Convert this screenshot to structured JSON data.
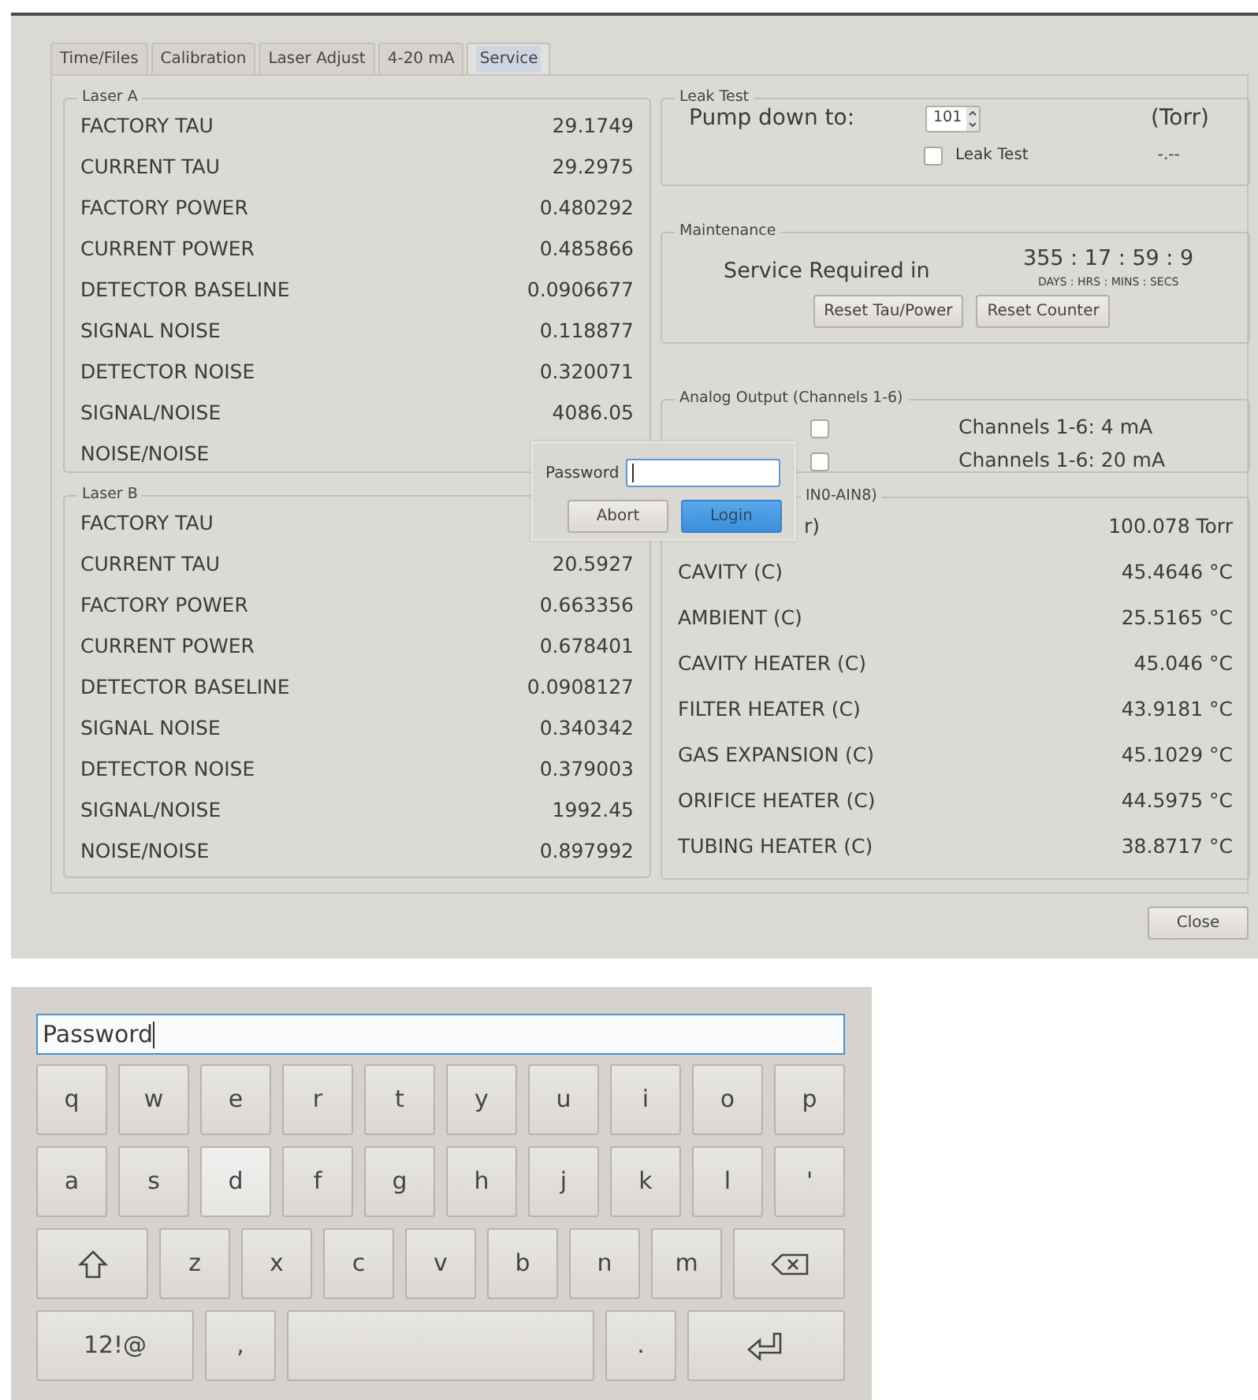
{
  "tabs": [
    {
      "label": "Time/Files",
      "selected": false
    },
    {
      "label": "Calibration",
      "selected": false
    },
    {
      "label": "Laser Adjust",
      "selected": false
    },
    {
      "label": "4-20 mA",
      "selected": false
    },
    {
      "label": "Service",
      "selected": true
    }
  ],
  "laser_a": {
    "title": "Laser A",
    "rows": [
      {
        "label": "FACTORY TAU",
        "value": "29.1749"
      },
      {
        "label": "CURRENT TAU",
        "value": "29.2975"
      },
      {
        "label": "FACTORY POWER",
        "value": "0.480292"
      },
      {
        "label": "CURRENT POWER",
        "value": "0.485866"
      },
      {
        "label": "DETECTOR BASELINE",
        "value": "0.0906677"
      },
      {
        "label": "SIGNAL NOISE",
        "value": "0.118877"
      },
      {
        "label": "DETECTOR NOISE",
        "value": "0.320071"
      },
      {
        "label": "SIGNAL/NOISE",
        "value": "4086.05"
      },
      {
        "label": "NOISE/NOISE"
      }
    ]
  },
  "laser_b": {
    "title": "Laser B",
    "rows": [
      {
        "label": "FACTORY TAU"
      },
      {
        "label": "CURRENT TAU",
        "value": "20.5927"
      },
      {
        "label": "FACTORY POWER",
        "value": "0.663356"
      },
      {
        "label": "CURRENT POWER",
        "value": "0.678401"
      },
      {
        "label": "DETECTOR BASELINE",
        "value": "0.0908127"
      },
      {
        "label": "SIGNAL NOISE",
        "value": "0.340342"
      },
      {
        "label": "DETECTOR NOISE",
        "value": "0.379003"
      },
      {
        "label": "SIGNAL/NOISE",
        "value": "1992.45"
      },
      {
        "label": "NOISE/NOISE",
        "value": "0.897992"
      }
    ]
  },
  "leak_test": {
    "title": "Leak Test",
    "pump_label": "Pump down to:",
    "pump_value": "101",
    "unit": "(Torr)",
    "checkbox": {
      "label": "Leak Test",
      "checked": false
    },
    "reading": "-.--"
  },
  "maintenance": {
    "title": "Maintenance",
    "label": "Service Required in",
    "countdown": "355 : 17 : 59 : 9",
    "units": "DAYS : HRS : MINS : SECS",
    "buttons": [
      "Reset Tau/Power",
      "Reset Counter"
    ]
  },
  "analog_output": {
    "title": "Analog Output (Channels 1-6)",
    "options": [
      {
        "label": "Channels 1-6: 4 mA",
        "checked": false
      },
      {
        "label": "Channels 1-6: 20 mA",
        "checked": false
      }
    ]
  },
  "analog_inputs": {
    "title": "IN0-AIN8)",
    "rows": [
      {
        "label": "r)",
        "value": "100.078 Torr"
      },
      {
        "label": "CAVITY (C)",
        "value": "45.4646 °C"
      },
      {
        "label": "AMBIENT (C)",
        "value": "25.5165 °C"
      },
      {
        "label": "CAVITY HEATER (C)",
        "value": "45.046 °C"
      },
      {
        "label": "FILTER HEATER (C)",
        "value": "43.9181 °C"
      },
      {
        "label": "GAS EXPANSION (C)",
        "value": "45.1029 °C"
      },
      {
        "label": "ORIFICE HEATER (C)",
        "value": "44.5975 °C"
      },
      {
        "label": "TUBING HEATER (C)",
        "value": "38.8717 °C"
      }
    ]
  },
  "password_dialog": {
    "label": "Password",
    "buttons": [
      {
        "label": "Abort",
        "default": false
      },
      {
        "label": "Login",
        "default": true
      }
    ]
  },
  "close_button": "Close",
  "keyboard": {
    "field_value": "Password",
    "top_row": [
      {
        "kind": "char",
        "label": "q",
        "pressed": false
      },
      {
        "kind": "char",
        "label": "w",
        "pressed": false
      },
      {
        "kind": "char",
        "label": "e",
        "pressed": false
      },
      {
        "kind": "char",
        "label": "r",
        "pressed": false
      },
      {
        "kind": "char",
        "label": "t",
        "pressed": false
      },
      {
        "kind": "char",
        "label": "y",
        "pressed": false
      },
      {
        "kind": "char",
        "label": "u",
        "pressed": false
      },
      {
        "kind": "char",
        "label": "i",
        "pressed": false
      },
      {
        "kind": "char",
        "label": "o",
        "pressed": false
      },
      {
        "kind": "char",
        "label": "p",
        "pressed": false
      }
    ],
    "home_row": [
      {
        "kind": "char",
        "label": "a",
        "pressed": false
      },
      {
        "kind": "char",
        "label": "s",
        "pressed": false
      },
      {
        "kind": "char",
        "label": "d",
        "pressed": true
      },
      {
        "kind": "char",
        "label": "f",
        "pressed": false
      },
      {
        "kind": "char",
        "label": "g",
        "pressed": false
      },
      {
        "kind": "char",
        "label": "h",
        "pressed": false
      },
      {
        "kind": "char",
        "label": "j",
        "pressed": false
      },
      {
        "kind": "char",
        "label": "k",
        "pressed": false
      },
      {
        "kind": "char",
        "label": "l",
        "pressed": false
      },
      {
        "kind": "char",
        "label": "'",
        "pressed": false
      }
    ],
    "bottom_row": [
      {
        "kind": "shift",
        "pressed": false
      },
      {
        "kind": "char",
        "label": "z",
        "pressed": false
      },
      {
        "kind": "char",
        "label": "x",
        "pressed": false
      },
      {
        "kind": "char",
        "label": "c",
        "pressed": false
      },
      {
        "kind": "char",
        "label": "v",
        "pressed": false
      },
      {
        "kind": "char",
        "label": "b",
        "pressed": false
      },
      {
        "kind": "char",
        "label": "n",
        "pressed": false
      },
      {
        "kind": "char",
        "label": "m",
        "pressed": false
      },
      {
        "kind": "backspace",
        "pressed": false
      }
    ],
    "function_row": [
      {
        "kind": "mode",
        "label": "12!@",
        "pressed": false
      },
      {
        "kind": "char",
        "label": ",",
        "pressed": false
      },
      {
        "kind": "space",
        "pressed": false
      },
      {
        "kind": "char",
        "label": ".",
        "pressed": false
      },
      {
        "kind": "enter",
        "pressed": false
      }
    ]
  }
}
